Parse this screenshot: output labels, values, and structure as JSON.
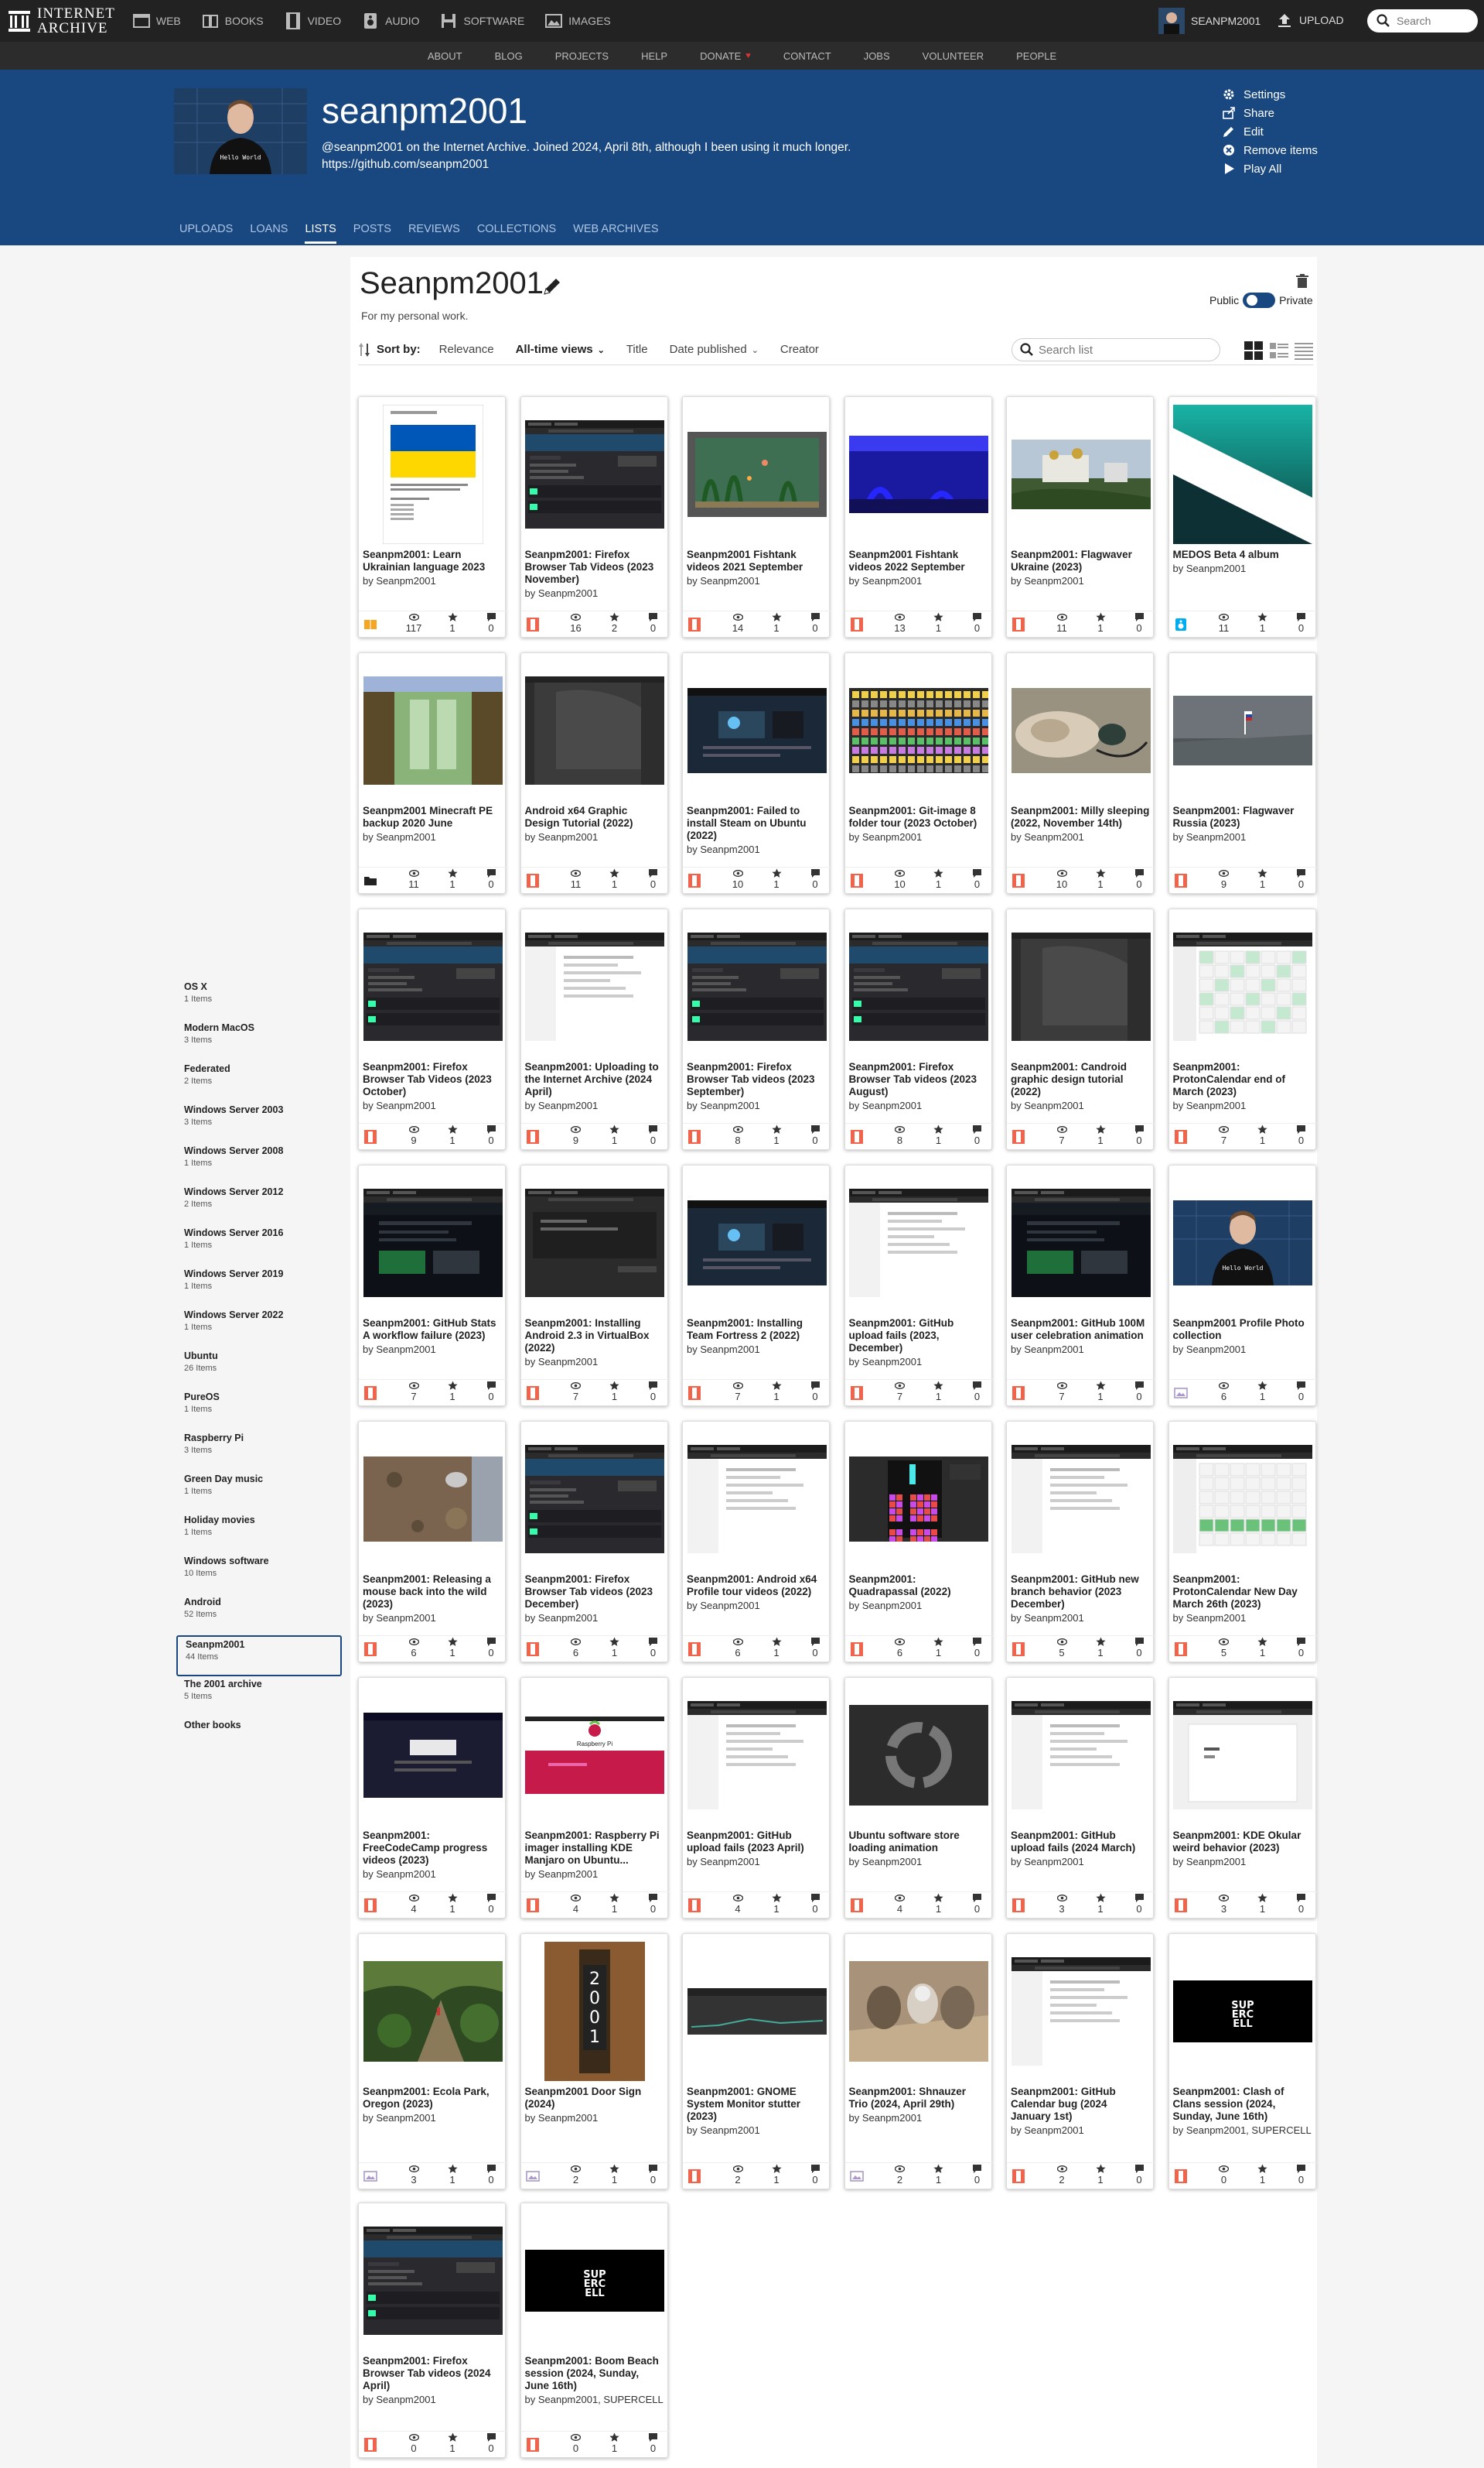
{
  "topbar": {
    "logo_line1": "INTERNET",
    "logo_line2": "ARCHIVE",
    "media": [
      "WEB",
      "BOOKS",
      "VIDEO",
      "AUDIO",
      "SOFTWARE",
      "IMAGES"
    ],
    "username": "SEANPM2001",
    "upload": "UPLOAD",
    "search_placeholder": "Search"
  },
  "subnav": [
    "ABOUT",
    "BLOG",
    "PROJECTS",
    "HELP",
    "DONATE",
    "CONTACT",
    "JOBS",
    "VOLUNTEER",
    "PEOPLE"
  ],
  "profile": {
    "name": "seanpm2001",
    "bio": "@seanpm2001 on the Internet Archive. Joined 2024, April 8th, although I been using it much longer.",
    "link": "https://github.com/seanpm2001",
    "actions": [
      "Settings",
      "Share",
      "Edit",
      "Remove items",
      "Play All"
    ],
    "tabs": [
      "UPLOADS",
      "LOANS",
      "LISTS",
      "POSTS",
      "REVIEWS",
      "COLLECTIONS",
      "WEB ARCHIVES"
    ],
    "active_tab": "LISTS"
  },
  "list": {
    "title": "Seanpm2001",
    "description": "For my personal work.",
    "public_label": "Public",
    "private_label": "Private",
    "sort_label": "Sort by:",
    "sort_options": [
      "Relevance",
      "All-time views",
      "Title",
      "Date published",
      "Creator"
    ],
    "active_sort": "All-time views",
    "search_placeholder": "Search list"
  },
  "sidebar": [
    {
      "name": "OS X",
      "count": "1 Items"
    },
    {
      "name": "Modern MacOS",
      "count": "3 Items"
    },
    {
      "name": "Federated",
      "count": "2 Items"
    },
    {
      "name": "Windows Server 2003",
      "count": "3 Items"
    },
    {
      "name": "Windows Server 2008",
      "count": "1 Items"
    },
    {
      "name": "Windows Server 2012",
      "count": "2 Items"
    },
    {
      "name": "Windows Server 2016",
      "count": "1 Items"
    },
    {
      "name": "Windows Server 2019",
      "count": "1 Items"
    },
    {
      "name": "Windows Server 2022",
      "count": "1 Items"
    },
    {
      "name": "Ubuntu",
      "count": "26 Items"
    },
    {
      "name": "PureOS",
      "count": "1 Items"
    },
    {
      "name": "Raspberry Pi",
      "count": "3 Items"
    },
    {
      "name": "Green Day music",
      "count": "1 Items"
    },
    {
      "name": "Holiday movies",
      "count": "1 Items"
    },
    {
      "name": "Windows software",
      "count": "10 Items"
    },
    {
      "name": "Android",
      "count": "52 Items"
    },
    {
      "name": "Seanpm2001",
      "count": "44 Items",
      "selected": true
    },
    {
      "name": "The 2001 archive",
      "count": "5 Items"
    },
    {
      "name": "Other books",
      "count": ""
    }
  ],
  "items": [
    {
      "title": "Seanpm2001: Learn Ukrainian language 2023",
      "by": "by Seanpm2001",
      "views": "117",
      "favs": "1",
      "reviews": "0",
      "media": "texts",
      "thumb": "ukraine"
    },
    {
      "title": "Seanpm2001: Firefox Browser Tab Videos (2023 November)",
      "by": "by Seanpm2001",
      "views": "16",
      "favs": "2",
      "reviews": "0",
      "media": "movies",
      "thumb": "firefox"
    },
    {
      "title": "Seanpm2001 Fishtank videos 2021 September",
      "by": "by Seanpm2001",
      "views": "14",
      "favs": "1",
      "reviews": "0",
      "media": "movies",
      "thumb": "fishtank1"
    },
    {
      "title": "Seanpm2001 Fishtank videos 2022 September",
      "by": "by Seanpm2001",
      "views": "13",
      "favs": "1",
      "reviews": "0",
      "media": "movies",
      "thumb": "fishtank2"
    },
    {
      "title": "Seanpm2001: Flagwaver Ukraine (2023)",
      "by": "by Seanpm2001",
      "views": "11",
      "favs": "1",
      "reviews": "0",
      "media": "movies",
      "thumb": "flagua"
    },
    {
      "title": "MEDOS Beta 4 album",
      "by": "by Seanpm2001",
      "views": "11",
      "favs": "1",
      "reviews": "0",
      "media": "audio",
      "thumb": "medos"
    },
    {
      "title": "Seanpm2001 Minecraft PE backup 2020 June",
      "by": "by Seanpm2001",
      "views": "11",
      "favs": "1",
      "reviews": "0",
      "media": "folder",
      "thumb": "minecraft"
    },
    {
      "title": "Android x64 Graphic Design Tutorial (2022)",
      "by": "by Seanpm2001",
      "views": "11",
      "favs": "1",
      "reviews": "0",
      "media": "movies",
      "thumb": "darkapp"
    },
    {
      "title": "Seanpm2001: Failed to install Steam on Ubuntu (2022)",
      "by": "by Seanpm2001",
      "views": "10",
      "favs": "1",
      "reviews": "0",
      "media": "movies",
      "thumb": "steam"
    },
    {
      "title": "Seanpm2001: Git-image 8 folder tour (2023 October)",
      "by": "by Seanpm2001",
      "views": "10",
      "favs": "1",
      "reviews": "0",
      "media": "movies",
      "thumb": "icons"
    },
    {
      "title": "Seanpm2001: Milly sleeping (2022, November 14th)",
      "by": "by Seanpm2001",
      "views": "10",
      "favs": "1",
      "reviews": "0",
      "media": "movies",
      "thumb": "dog"
    },
    {
      "title": "Seanpm2001: Flagwaver Russia (2023)",
      "by": "by Seanpm2001",
      "views": "9",
      "favs": "1",
      "reviews": "0",
      "media": "movies",
      "thumb": "flagru"
    },
    {
      "title": "Seanpm2001: Firefox Browser Tab Videos (2023 October)",
      "by": "by Seanpm2001",
      "views": "9",
      "favs": "1",
      "reviews": "0",
      "media": "movies",
      "thumb": "firefox"
    },
    {
      "title": "Seanpm2001: Uploading to the Internet Archive (2024 April)",
      "by": "by Seanpm2001",
      "views": "9",
      "favs": "1",
      "reviews": "0",
      "media": "movies",
      "thumb": "webwhite"
    },
    {
      "title": "Seanpm2001: Firefox Browser Tab videos (2023 September)",
      "by": "by Seanpm2001",
      "views": "8",
      "favs": "1",
      "reviews": "0",
      "media": "movies",
      "thumb": "firefox"
    },
    {
      "title": "Seanpm2001: Firefox Browser Tab videos (2023 August)",
      "by": "by Seanpm2001",
      "views": "8",
      "favs": "1",
      "reviews": "0",
      "media": "movies",
      "thumb": "firefox"
    },
    {
      "title": "Seanpm2001: Candroid graphic design tutorial (2022)",
      "by": "by Seanpm2001",
      "views": "7",
      "favs": "1",
      "reviews": "0",
      "media": "movies",
      "thumb": "darkapp"
    },
    {
      "title": "Seanpm2001: ProtonCalendar end of March (2023)",
      "by": "by Seanpm2001",
      "views": "7",
      "favs": "1",
      "reviews": "0",
      "media": "movies",
      "thumb": "calendar"
    },
    {
      "title": "Seanpm2001: GitHub Stats A workflow failure (2023)",
      "by": "by Seanpm2001",
      "views": "7",
      "favs": "1",
      "reviews": "0",
      "media": "movies",
      "thumb": "webdark"
    },
    {
      "title": "Seanpm2001: Installing Android 2.3 in VirtualBox (2022)",
      "by": "by Seanpm2001",
      "views": "7",
      "favs": "1",
      "reviews": "0",
      "media": "movies",
      "thumb": "darkapp2"
    },
    {
      "title": "Seanpm2001: Installing Team Fortress 2 (2022)",
      "by": "by Seanpm2001",
      "views": "7",
      "favs": "1",
      "reviews": "0",
      "media": "movies",
      "thumb": "steam"
    },
    {
      "title": "Seanpm2001: GitHub upload fails (2023, December)",
      "by": "by Seanpm2001",
      "views": "7",
      "favs": "1",
      "reviews": "0",
      "media": "movies",
      "thumb": "webwhite"
    },
    {
      "title": "Seanpm2001: GitHub 100M user celebration animation",
      "by": "by Seanpm2001",
      "views": "7",
      "favs": "1",
      "reviews": "0",
      "media": "movies",
      "thumb": "webdark"
    },
    {
      "title": "Seanpm2001 Profile Photo collection",
      "by": "by Seanpm2001",
      "views": "6",
      "favs": "1",
      "reviews": "0",
      "media": "image",
      "thumb": "portrait"
    },
    {
      "title": "Seanpm2001: Releasing a mouse back into the wild (2023)",
      "by": "by Seanpm2001",
      "views": "6",
      "favs": "1",
      "reviews": "0",
      "media": "movies",
      "thumb": "ground"
    },
    {
      "title": "Seanpm2001: Firefox Browser Tab videos (2023 December)",
      "by": "by Seanpm2001",
      "views": "6",
      "favs": "1",
      "reviews": "0",
      "media": "movies",
      "thumb": "firefox"
    },
    {
      "title": "Seanpm2001: Android x64 Profile tour videos (2022)",
      "by": "by Seanpm2001",
      "views": "6",
      "favs": "1",
      "reviews": "0",
      "media": "movies",
      "thumb": "webwhite"
    },
    {
      "title": "Seanpm2001: Quadrapassal (2022)",
      "by": "by Seanpm2001",
      "views": "6",
      "favs": "1",
      "reviews": "0",
      "media": "movies",
      "thumb": "tetris"
    },
    {
      "title": "Seanpm2001: GitHub new branch behavior (2023 December)",
      "by": "by Seanpm2001",
      "views": "5",
      "favs": "1",
      "reviews": "0",
      "media": "movies",
      "thumb": "webwhite"
    },
    {
      "title": "Seanpm2001: ProtonCalendar New Day March 26th (2023)",
      "by": "by Seanpm2001",
      "views": "5",
      "favs": "1",
      "reviews": "0",
      "media": "movies",
      "thumb": "calendar2"
    },
    {
      "title": "Seanpm2001: FreeCodeCamp progress videos (2023)",
      "by": "by Seanpm2001",
      "views": "4",
      "favs": "1",
      "reviews": "0",
      "media": "movies",
      "thumb": "fcc"
    },
    {
      "title": "Seanpm2001: Raspberry Pi imager installing KDE Manjaro on Ubuntu...",
      "by": "by Seanpm2001",
      "views": "4",
      "favs": "1",
      "reviews": "0",
      "media": "movies",
      "thumb": "rpi"
    },
    {
      "title": "Seanpm2001: GitHub upload fails (2023 April)",
      "by": "by Seanpm2001",
      "views": "4",
      "favs": "1",
      "reviews": "0",
      "media": "movies",
      "thumb": "webwhite"
    },
    {
      "title": "Ubuntu software store loading animation",
      "by": "by Seanpm2001",
      "views": "4",
      "favs": "1",
      "reviews": "0",
      "media": "movies",
      "thumb": "spinner"
    },
    {
      "title": "Seanpm2001: GitHub upload fails (2024 March)",
      "by": "by Seanpm2001",
      "views": "3",
      "favs": "1",
      "reviews": "0",
      "media": "movies",
      "thumb": "webwhite"
    },
    {
      "title": "Seanpm2001: KDE Okular weird behavior (2023)",
      "by": "by Seanpm2001",
      "views": "3",
      "favs": "1",
      "reviews": "0",
      "media": "movies",
      "thumb": "okular"
    },
    {
      "title": "Seanpm2001: Ecola Park, Oregon (2023)",
      "by": "by Seanpm2001",
      "views": "3",
      "favs": "1",
      "reviews": "0",
      "media": "image",
      "thumb": "forest"
    },
    {
      "title": "Seanpm2001 Door Sign (2024)",
      "by": "by Seanpm2001",
      "views": "2",
      "favs": "1",
      "reviews": "0",
      "media": "image",
      "thumb": "doorsign"
    },
    {
      "title": "Seanpm2001: GNOME System Monitor stutter (2023)",
      "by": "by Seanpm2001",
      "views": "2",
      "favs": "1",
      "reviews": "0",
      "media": "movies",
      "thumb": "monitor"
    },
    {
      "title": "Seanpm2001: Shnauzer Trio (2024, April 29th)",
      "by": "by Seanpm2001",
      "views": "2",
      "favs": "1",
      "reviews": "0",
      "media": "image",
      "thumb": "dogs"
    },
    {
      "title": "Seanpm2001: GitHub Calendar bug (2024 January 1st)",
      "by": "by Seanpm2001",
      "views": "2",
      "favs": "1",
      "reviews": "0",
      "media": "movies",
      "thumb": "webwhite"
    },
    {
      "title": "Seanpm2001: Clash of Clans session (2024, Sunday, June 16th)",
      "by": "by Seanpm2001, SUPERCELL",
      "views": "0",
      "favs": "1",
      "reviews": "0",
      "media": "movies",
      "thumb": "supercell"
    },
    {
      "title": "Seanpm2001: Firefox Browser Tab videos (2024 April)",
      "by": "by Seanpm2001",
      "views": "0",
      "favs": "1",
      "reviews": "0",
      "media": "movies",
      "thumb": "firefox"
    },
    {
      "title": "Seanpm2001: Boom Beach session (2024, Sunday, June 16th)",
      "by": "by Seanpm2001, SUPERCELL",
      "views": "0",
      "favs": "1",
      "reviews": "0",
      "media": "movies",
      "thumb": "supercell"
    }
  ]
}
